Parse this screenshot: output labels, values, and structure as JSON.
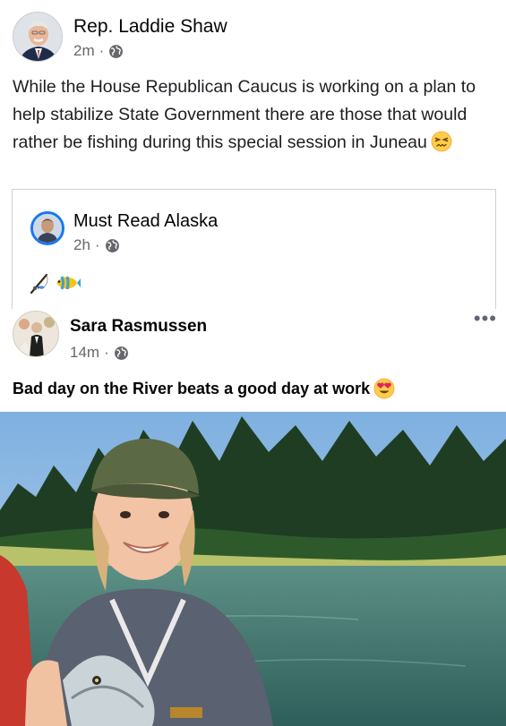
{
  "post1": {
    "author": "Rep. Laddie Shaw",
    "time": "2m",
    "separator": "·",
    "text": "While the House Republican Caucus is working on a plan to help stabilize State Government there are those that would rather be fishing during this special session in Juneau",
    "emoji": "confounded-face-icon",
    "shared": {
      "author": "Must Read Alaska",
      "time": "2h",
      "separator": "·",
      "emojis": [
        "fishing-pole-icon",
        "tropical-fish-icon"
      ]
    }
  },
  "post2": {
    "author": "Sara Rasmussen",
    "time": "14m",
    "separator": "·",
    "more": "•••",
    "text": "Bad day on the River beats a good day at work",
    "emoji": "heart-eyes-icon"
  },
  "colors": {
    "meta_gray": "#65676b",
    "border": "#ced0d4",
    "accent_blue": "#1877f2"
  }
}
